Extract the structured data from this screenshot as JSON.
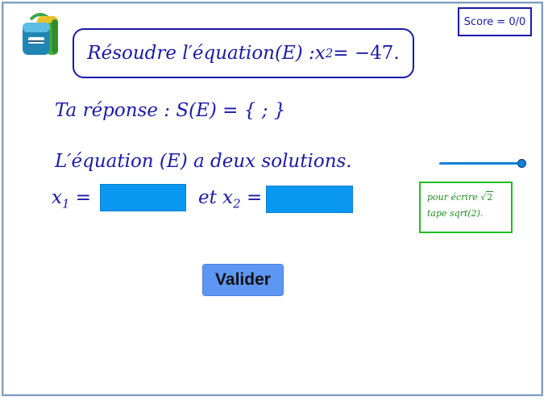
{
  "score": {
    "text": "Score = 0/0"
  },
  "equation": {
    "prefix": "Résoudre l′équation(E) : ",
    "var": "x",
    "exp": "2",
    "rhs": " = −47."
  },
  "answer": {
    "label": "Ta réponse : ",
    "set": "S(E) = { ; }"
  },
  "solutions": {
    "text": "L′équation (E) a deux solutions."
  },
  "inputs": {
    "x1": {
      "var": "x",
      "sub": "1",
      "eq": " =",
      "value": ""
    },
    "connector": "et ",
    "x2": {
      "var": "x",
      "sub": "2",
      "eq": " =",
      "value": ""
    }
  },
  "hint": {
    "line1": "pour écrire ",
    "radicand": "2",
    "line2": "tape sqrt(2)."
  },
  "buttons": {
    "validate": "Valider"
  },
  "slider": {
    "value": 1.0
  },
  "colors": {
    "math": "#1a1aa8",
    "input_fill": "#0a97f0",
    "button": "#5e97f3",
    "hint": "#1c8f1c"
  },
  "icons": {
    "logo": "backpack-icon"
  }
}
